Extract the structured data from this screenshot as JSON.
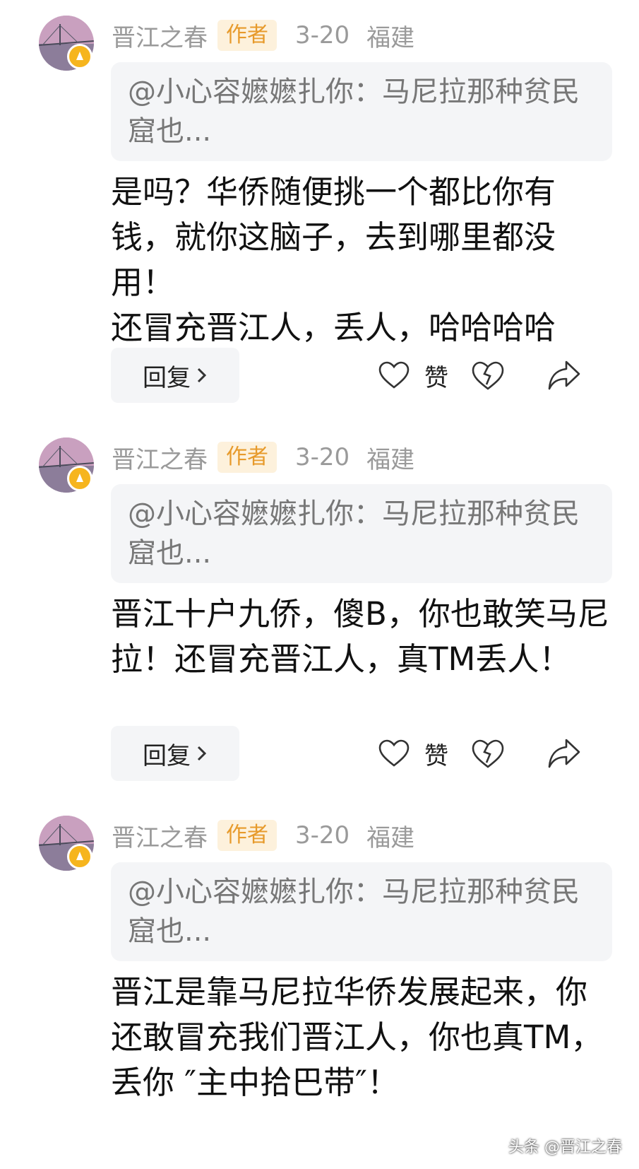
{
  "comments": [
    {
      "author": "晋江之春",
      "author_badge": "作者",
      "date": "3-20",
      "location": "福建",
      "quote": "@小心容嬷嬷扎你：马尼拉那种贫民窟也...",
      "body": "是吗？华侨随便挑一个都比你有钱，就你这脑子，去到哪里都没用！\n还冒充晋江人，丢人，哈哈哈哈",
      "reply_label": "回复",
      "like_label": "赞"
    },
    {
      "author": "晋江之春",
      "author_badge": "作者",
      "date": "3-20",
      "location": "福建",
      "quote": "@小心容嬷嬷扎你：马尼拉那种贫民窟也...",
      "body": "晋江十户九侨，傻B，你也敢笑马尼拉！还冒充晋江人，真TM丢人！",
      "reply_label": "回复",
      "like_label": "赞"
    },
    {
      "author": "晋江之春",
      "author_badge": "作者",
      "date": "3-20",
      "location": "福建",
      "quote": "@小心容嬷嬷扎你：马尼拉那种贫民窟也...",
      "body": "晋江是靠马尼拉华侨发展起来，你还敢冒充我们晋江人，你也真TM，丢你 ″主中拾巴带″！"
    }
  ],
  "watermark": "头条 @晋江之春",
  "colors": {
    "meta_gray": "#9a9a9a",
    "author_badge_bg": "#fdf1dc",
    "author_badge_text": "#e79a2b",
    "quote_bg": "#f4f5f7",
    "avatar_badge": "#f6b51e"
  },
  "icons": [
    "heart-icon",
    "broken-heart-icon",
    "share-icon",
    "chevron-right-icon"
  ]
}
